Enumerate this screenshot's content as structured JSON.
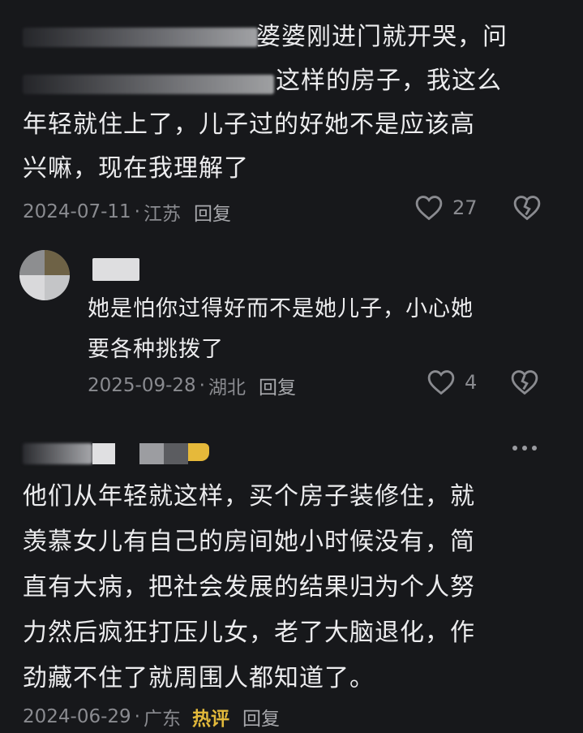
{
  "comment1": {
    "lines": [
      "婆婆刚进门就开哭，问",
      "这样的房子，我这么",
      "年轻就住上了，儿子过的好她不是应该高",
      "兴嘛，现在我理解了"
    ],
    "date": "2024-07-11",
    "sep": "·",
    "location": "江苏",
    "reply_label": "回复",
    "like_count": "27"
  },
  "reply1": {
    "lines": [
      "她是怕你过得好而不是她儿子，小心她",
      "要各种挑拨了"
    ],
    "date": "2025-09-28",
    "sep": "·",
    "location": "湖北",
    "reply_label": "回复",
    "like_count": "4"
  },
  "comment2": {
    "lines": [
      "他们从年轻就这样，买个房子装修住，就",
      "羡慕女儿有自己的房间她小时候没有，简",
      "直有大病，把社会发展的结果归为个人努",
      "力然后疯狂打压儿女，老了大脑退化，作",
      "劲藏不住了就周围人都知道了。"
    ],
    "date": "2024-06-29",
    "sep": "·",
    "location": "广东",
    "hot_label": "热评",
    "reply_label": "回复"
  },
  "icons": {
    "like": "heart-icon",
    "dislike": "broken-heart-icon",
    "more": "more-dots-icon"
  },
  "colors": {
    "background": "#17181b",
    "hot": "#e2b93b",
    "meta": "#8a8b90"
  }
}
